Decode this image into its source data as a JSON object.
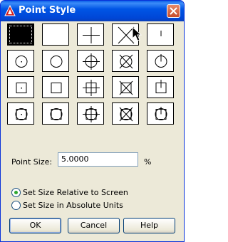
{
  "window": {
    "title": "Point Style"
  },
  "point_size": {
    "label": "Point Size:",
    "value": "5.0000",
    "unit": "%"
  },
  "radio_options": [
    {
      "label": "Set Size Relative to Screen",
      "selected": true
    },
    {
      "label": "Set Size in Absolute Units",
      "selected": false
    }
  ],
  "buttons": {
    "ok": "OK",
    "cancel": "Cancel",
    "help": "Help"
  },
  "colors": {
    "title_bar": "#0055e5",
    "dialog_bg": "#ece9d8",
    "close_button": "#c74c2a",
    "selected_tile": "#000000"
  },
  "icons": [
    "autocad-app-icon",
    "close-icon",
    "mouse-pointer-icon"
  ]
}
